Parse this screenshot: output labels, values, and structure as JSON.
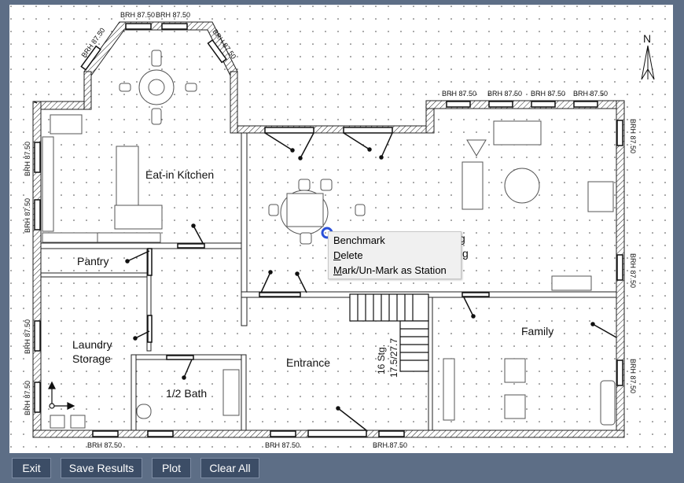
{
  "rooms": {
    "kitchen": "Eat-in Kitchen",
    "pantry": "Pantry",
    "laundry_line1": "Laundry",
    "laundry_line2": "Storage",
    "bath": "1/2 Bath",
    "entrance": "Entrance",
    "family": "Family",
    "stairs_line1": "16 Stg.",
    "stairs_line2": "17.5/27.7",
    "living_partial": "g",
    "living_partial2": "g"
  },
  "window_labels": {
    "top_left_1": "BRH 87.50",
    "top_left_2": "BRH 87.50",
    "diag_left": "BRH 87.50",
    "diag_right": "BRH 87.50",
    "top_right_1": "BRH 87.50",
    "top_right_2": "BRH 87.50",
    "top_right_3": "BRH 87.50",
    "top_right_4": "BRH 87.50",
    "left_1": "BRH 87.50",
    "left_2": "BRH 87.50",
    "left_3": "BRH 87.50",
    "left_4": "BRH 87.50",
    "bottom_1": "BRH 87.50",
    "bottom_2": "BRH 87.50",
    "bottom_3": "BRH 87.50",
    "right_1": "BRH 87.50",
    "right_2": "BRH 87.50",
    "right_3": "BRH 87.50"
  },
  "compass": {
    "label": "N"
  },
  "context_menu": {
    "items": [
      {
        "label": "Benchmark",
        "mnemonic": ""
      },
      {
        "label": "Delete",
        "mnemonic": "D"
      },
      {
        "label": "Mark/Un-Mark as Station",
        "mnemonic": "M"
      }
    ]
  },
  "buttons": {
    "exit": "Exit",
    "save": "Save Results",
    "plot": "Plot",
    "clear": "Clear All"
  },
  "colors": {
    "background": "#5d6e86",
    "canvas": "#ffffff",
    "button": "#3c4d66",
    "marker": "#2a50d8"
  }
}
